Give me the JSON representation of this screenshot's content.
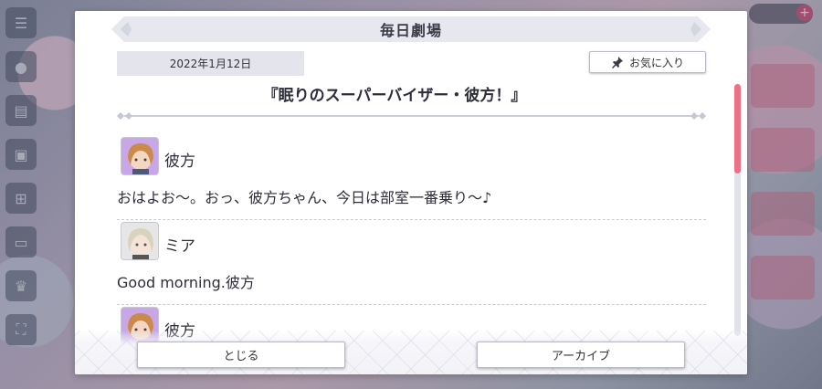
{
  "dialog": {
    "title": "毎日劇場",
    "date": "2022年1月12日",
    "favorite_label": "お気に入り",
    "episode_title": "『眠りのスーパーバイザー・彼方！』",
    "lines": [
      {
        "speaker": "彼方",
        "text": "おはよお〜。おっ、彼方ちゃん、今日は部室一番乗り〜♪",
        "avatar": "kanata"
      },
      {
        "speaker": "ミア",
        "text": "Good morning.彼方",
        "avatar": "mia"
      },
      {
        "speaker": "彼方",
        "text": "",
        "avatar": "kanata"
      }
    ],
    "close_label": "とじる",
    "archive_label": "アーカイブ"
  },
  "colors": {
    "accent": "#ef6f86",
    "title_bar": "#e7e8ef",
    "date_box": "#e4e5ec"
  }
}
